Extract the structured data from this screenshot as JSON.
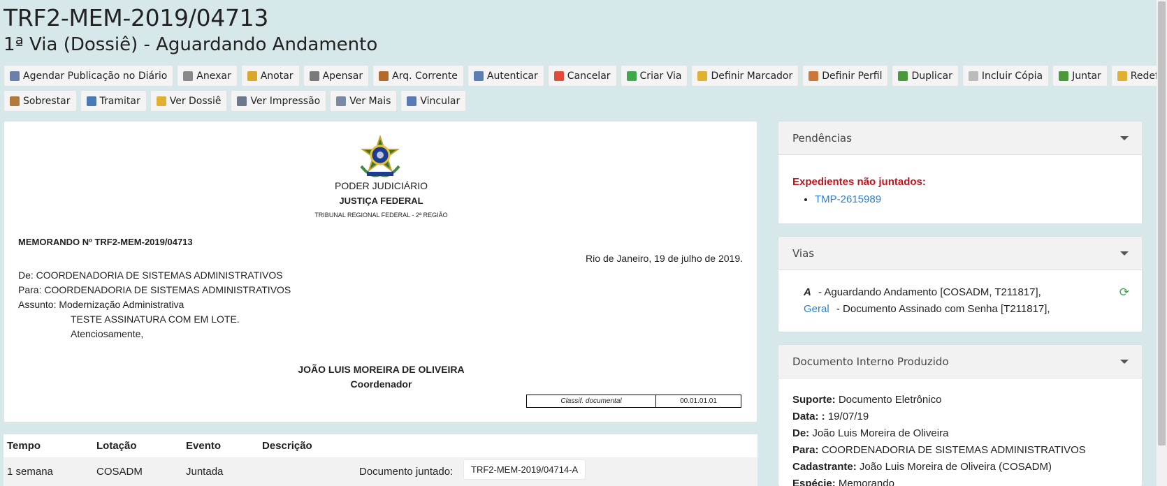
{
  "header": {
    "title": "TRF2-MEM-2019/04713",
    "subtitle": "1ª Via (Dossiê) - Aguardando Andamento"
  },
  "toolbar": {
    "row1": [
      {
        "label": "Agendar Publicação no Diário",
        "icon": "calendar-icon",
        "color": "#6b7fa8"
      },
      {
        "label": "Anexar",
        "icon": "paperclip-icon",
        "color": "#8a8a8a"
      },
      {
        "label": "Anotar",
        "icon": "note-icon",
        "color": "#d9a82b"
      },
      {
        "label": "Apensar",
        "icon": "link-icon",
        "color": "#7a7a7a"
      },
      {
        "label": "Arq. Corrente",
        "icon": "archive-box-icon",
        "color": "#b36b2c"
      },
      {
        "label": "Autenticar",
        "icon": "certificate-icon",
        "color": "#5b7fb3"
      },
      {
        "label": "Cancelar",
        "icon": "cancel-icon",
        "color": "#e04a3a"
      },
      {
        "label": "Criar Via",
        "icon": "add-icon",
        "color": "#3fa84a"
      },
      {
        "label": "Definir Marcador",
        "icon": "folder-marker-icon",
        "color": "#e0b030"
      },
      {
        "label": "Definir Perfil",
        "icon": "user-profile-icon",
        "color": "#c9783a"
      },
      {
        "label": "Duplicar",
        "icon": "branch-icon",
        "color": "#4a9a3c"
      },
      {
        "label": "Incluir Cópia",
        "icon": "copy-icon",
        "color": "#bbbbbb"
      },
      {
        "label": "Juntar",
        "icon": "page-arrow-icon",
        "color": "#4a9a3c"
      },
      {
        "label": "Redefinir Acesso",
        "icon": "shield-icon",
        "color": "#e0b030"
      }
    ],
    "row2": [
      {
        "label": "Sobrestar",
        "icon": "hourglass-icon",
        "color": "#b07a3a"
      },
      {
        "label": "Tramitar",
        "icon": "send-icon",
        "color": "#4a7ab3"
      },
      {
        "label": "Ver Dossiê",
        "icon": "folder-icon",
        "color": "#e0b030"
      },
      {
        "label": "Ver Impressão",
        "icon": "printer-icon",
        "color": "#6a7a8a"
      },
      {
        "label": "Ver Mais",
        "icon": "eye-icon",
        "color": "#7a8aa0"
      },
      {
        "label": "Vincular",
        "icon": "attach-icon",
        "color": "#5a7ab3"
      }
    ]
  },
  "document": {
    "org1": "PODER JUDICIÁRIO",
    "org2": "JUSTIÇA FEDERAL",
    "org3": "TRIBUNAL REGIONAL FEDERAL - 2ª REGIÃO",
    "memo_title": "MEMORANDO Nº TRF2-MEM-2019/04713",
    "date_line": "Rio de Janeiro, 19 de julho de 2019.",
    "from": "De: COORDENADORIA DE SISTEMAS ADMINISTRATIVOS",
    "to": "Para: COORDENADORIA DE SISTEMAS ADMINISTRATIVOS",
    "subject": "Assunto: Modernização Administrativa",
    "body": "TESTE ASSINATURA COM EM LOTE.",
    "closing": "Atenciosamente,",
    "signer": "JOÃO LUIS MOREIRA DE OLIVEIRA",
    "signer_role": "Coordenador",
    "classif_label": "Classif. documental",
    "classif_value": "00.01.01.01"
  },
  "events": {
    "headers": [
      "Tempo",
      "Lotação",
      "Evento",
      "Descrição"
    ],
    "row": {
      "tempo": "1 semana",
      "lotacao": "COSADM",
      "evento": "Juntada",
      "descricao_label": "Documento juntado:",
      "descricao_value": "TRF2-MEM-2019/04714-A"
    }
  },
  "pendencias": {
    "title": "Pendências",
    "heading": "Expedientes não juntados:",
    "items": [
      "TMP-2615989"
    ]
  },
  "vias": {
    "title": "Vias",
    "line1_key": "A",
    "line1_text": "-  Aguardando Andamento [COSADM, T211817],",
    "line2_key": "Geral",
    "line2_text": "-  Documento Assinado com Senha [T211817],"
  },
  "doc_info": {
    "title": "Documento Interno Produzido",
    "suporte_label": "Suporte:",
    "suporte_value": "Documento Eletrônico",
    "data_label": "Data: :",
    "data_value": "19/07/19",
    "de_label": "De:",
    "de_value": "João Luis Moreira de Oliveira",
    "para_label": "Para:",
    "para_value": "COORDENADORIA DE SISTEMAS ADMINISTRATIVOS",
    "cad_label": "Cadastrante:",
    "cad_value": "João Luis Moreira de Oliveira (COSADM)",
    "especie_label": "Espécie:",
    "especie_value": "Memorando"
  },
  "colors": {
    "background": "#d7e8ea",
    "link": "#2a7fd4",
    "alert": "#c0141c"
  }
}
